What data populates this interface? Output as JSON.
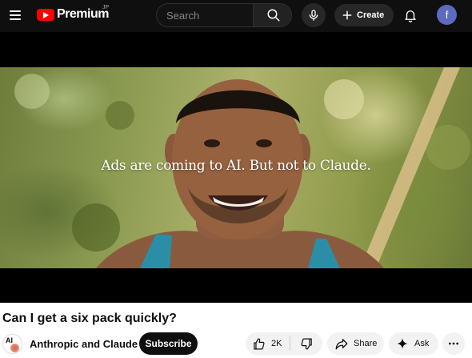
{
  "header": {
    "logo_text": "Premium",
    "logo_region": "JP",
    "search_placeholder": "Search",
    "create_label": "Create",
    "account_initial": "f"
  },
  "player": {
    "overlay_text": "Ads are coming to AI. But not to Claude."
  },
  "video": {
    "title": "Can I get a six pack quickly?",
    "channel_name": "Anthropic and Claude",
    "channel_avatar_text": "AI",
    "subscribe_label": "Subscribe",
    "like_count": "2K",
    "share_label": "Share",
    "ask_label": "Ask"
  },
  "icons": {
    "menu": "menu-icon",
    "search": "search-icon",
    "mic": "mic-icon",
    "create": "plus-icon",
    "notifications": "bell-icon",
    "like": "thumbs-up-icon",
    "dislike": "thumbs-down-icon",
    "share": "share-arrow-icon",
    "ask": "sparkle-icon",
    "more": "more-horizontal-icon"
  },
  "colors": {
    "topbar_bg": "#0f0f0f",
    "logo_red": "#ff0000",
    "avatar_bg": "#5c6bc0",
    "subscribe_bg": "#0f0f0f",
    "pill_bg": "#f2f2f2"
  }
}
